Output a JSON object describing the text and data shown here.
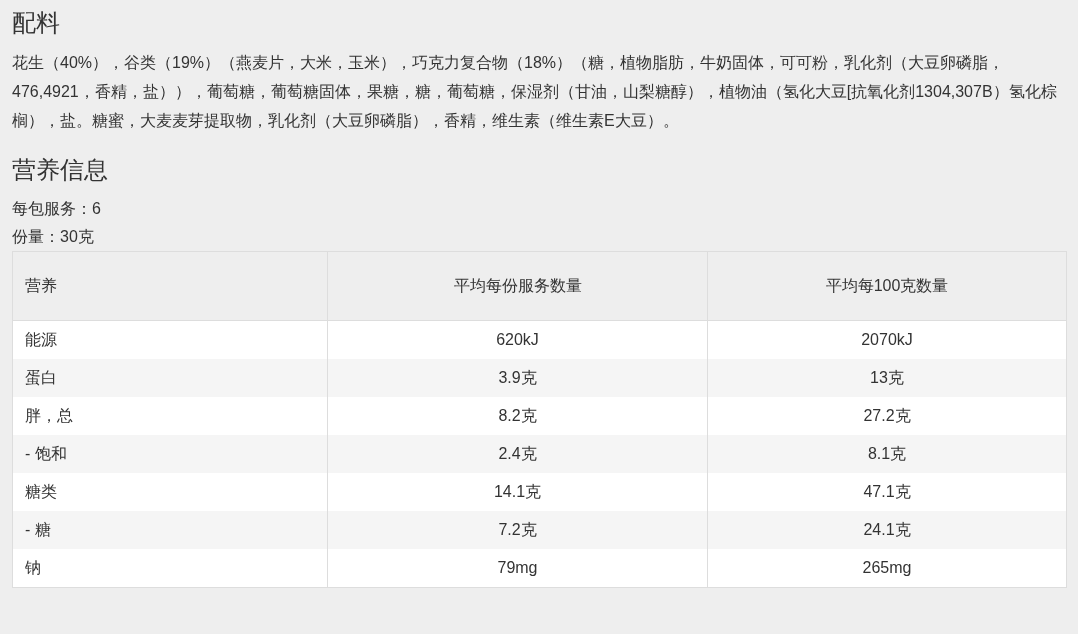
{
  "ingredients": {
    "heading": "配料",
    "text": "花生（40%），谷类（19%）（燕麦片，大米，玉米），巧克力复合物（18%）（糖，植物脂肪，牛奶固体，可可粉，乳化剂（大豆卵磷脂，476,4921，香精，盐）），葡萄糖，葡萄糖固体，果糖，糖，葡萄糖，保湿剂（甘油，山梨糖醇），植物油（氢化大豆[抗氧化剂1304,307B）氢化棕榈），盐。糖蜜，大麦麦芽提取物，乳化剂（大豆卵磷脂），香精，维生素（维生素E大豆）。"
  },
  "nutrition": {
    "heading": "营养信息",
    "servings_per_pack": "每包服务：6",
    "serving_size": "份量：30克",
    "table": {
      "columns": [
        "营养",
        "平均每份服务数量",
        "平均每100克数量"
      ],
      "rows": [
        [
          "能源",
          "620kJ",
          "2070kJ"
        ],
        [
          "蛋白",
          "3.9克",
          "13克"
        ],
        [
          "胖，总",
          "8.2克",
          "27.2克"
        ],
        [
          "- 饱和",
          "2.4克",
          "8.1克"
        ],
        [
          "糖类",
          "14.1克",
          "47.1克"
        ],
        [
          "- 糖",
          "7.2克",
          "24.1克"
        ],
        [
          "钠",
          "79mg",
          "265mg"
        ]
      ]
    }
  }
}
